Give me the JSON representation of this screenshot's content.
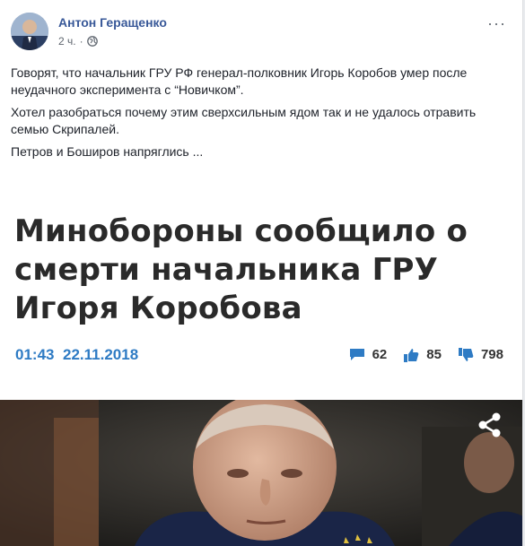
{
  "post": {
    "author": "Антон Геращенко",
    "time": "2 ч.",
    "paragraphs": [
      "Говорят, что начальник ГРУ РФ генерал-полковник Игорь Коробов умер после неудачного эксперимента с “Новичком”.",
      "Хотел разобраться почему этим сверхсильным ядом так и не удалось отравить семью Скрипалей.",
      "Петров и Боширов напряглись ..."
    ]
  },
  "article": {
    "title": "Минобороны сообщило о смерти начальника ГРУ Игоря Коробова",
    "time": "01:43",
    "date": "22.11.2018",
    "comments": "62",
    "likes": "85",
    "dislikes": "798"
  },
  "colors": {
    "link": "#385898",
    "accent": "#2e7bc4"
  },
  "icons": [
    "globe-icon",
    "more-icon",
    "comment-icon",
    "thumbs-up-icon",
    "thumbs-down-icon",
    "share-icon"
  ]
}
